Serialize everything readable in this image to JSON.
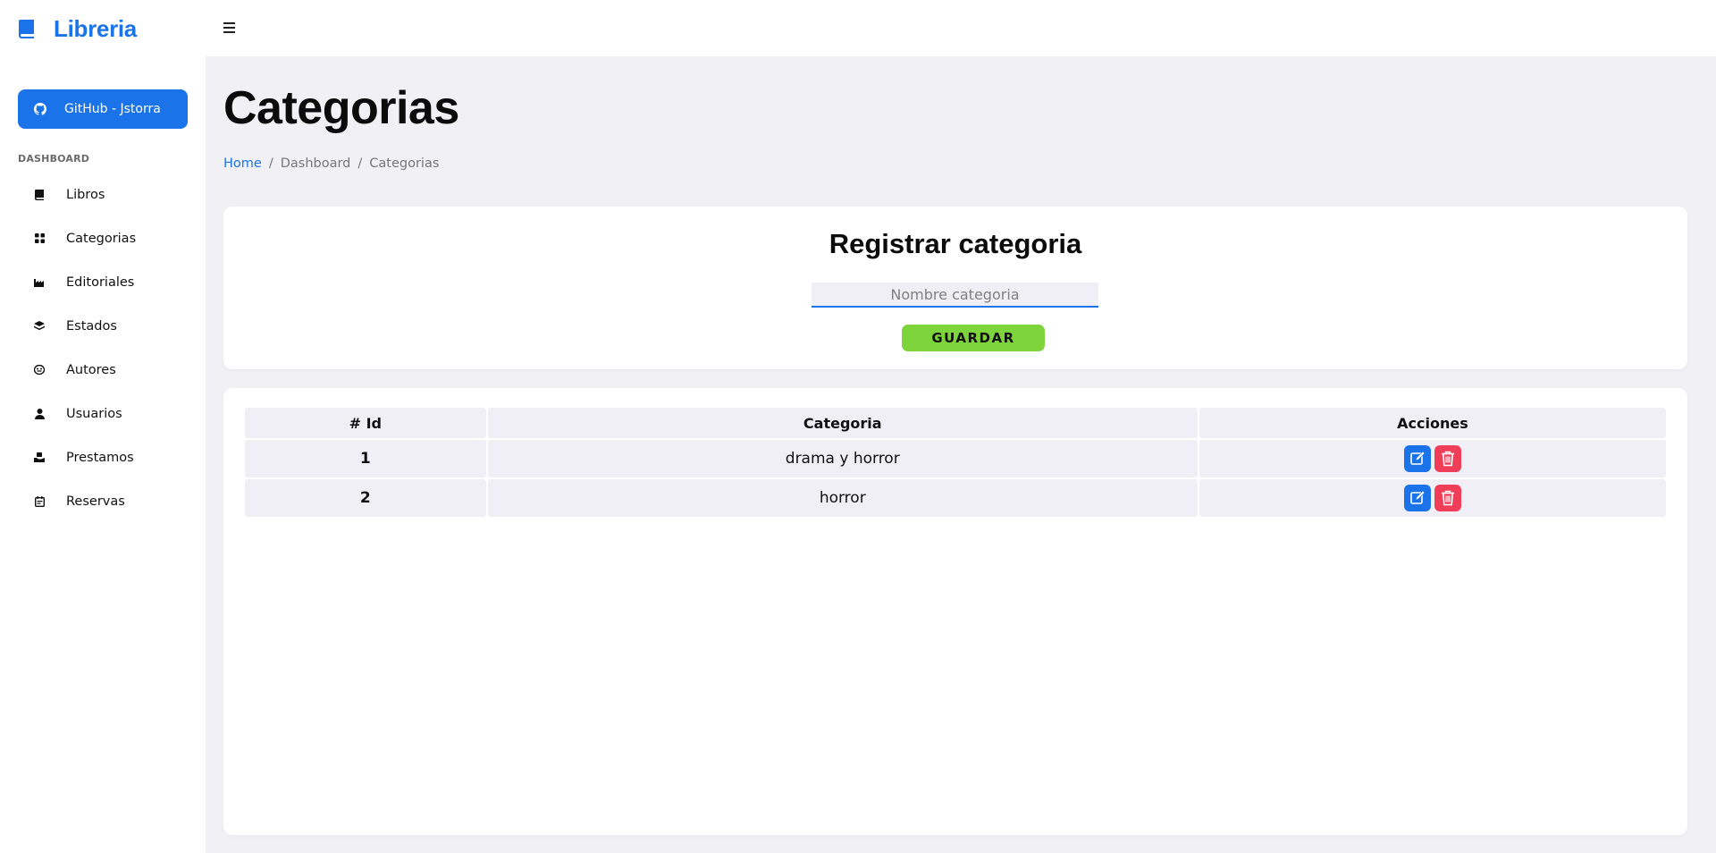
{
  "app": {
    "brand": "Libreria",
    "brand_color": "#1a73e8"
  },
  "sidebar": {
    "github_label": "GitHub - Jstorra",
    "section_label": "DASHBOARD",
    "items": [
      {
        "label": "Libros",
        "icon": "book-icon"
      },
      {
        "label": "Categorias",
        "icon": "grid-icon"
      },
      {
        "label": "Editoriales",
        "icon": "factory-icon"
      },
      {
        "label": "Estados",
        "icon": "layers-icon"
      },
      {
        "label": "Autores",
        "icon": "mask-icon"
      },
      {
        "label": "Usuarios",
        "icon": "user-icon"
      },
      {
        "label": "Prestamos",
        "icon": "hand-box-icon"
      },
      {
        "label": "Reservas",
        "icon": "calendar-icon"
      }
    ]
  },
  "page": {
    "title": "Categorias",
    "breadcrumb": [
      "Home",
      "Dashboard",
      "Categorias"
    ]
  },
  "form": {
    "title": "Registrar categoria",
    "input_placeholder": "Nombre categoria",
    "input_value": "",
    "save_label": "GUARDAR",
    "save_color": "#7ed43b"
  },
  "table": {
    "headers": [
      "# Id",
      "Categoria",
      "Acciones"
    ],
    "rows": [
      {
        "id": "1",
        "categoria": "drama y horror"
      },
      {
        "id": "2",
        "categoria": "horror"
      }
    ],
    "edit_color": "#1a73e8",
    "delete_color": "#f03e58"
  }
}
